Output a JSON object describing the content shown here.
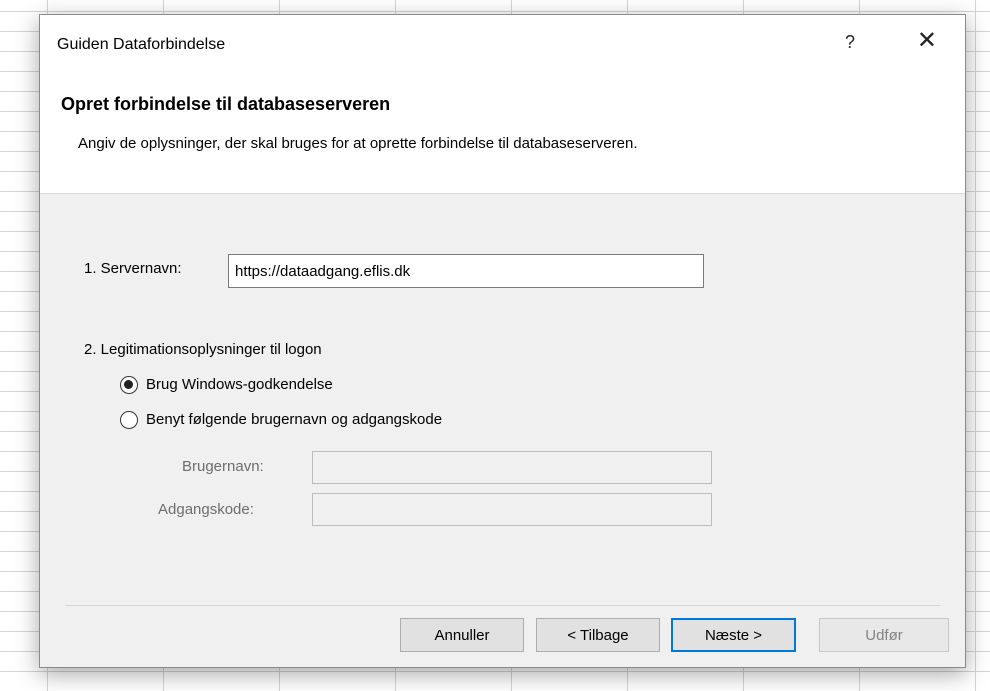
{
  "window": {
    "title": "Guiden Dataforbindelse",
    "help_label": "?",
    "close_label": "✕"
  },
  "header": {
    "title": "Opret forbindelse til databaseserveren",
    "description": "Angiv de oplysninger, der skal bruges for at oprette forbindelse til databaseserveren."
  },
  "server": {
    "label": "1. Servernavn:",
    "value": "https://dataadgang.eflis.dk"
  },
  "credentials": {
    "section_label": "2. Legitimationsoplysninger til logon",
    "options": [
      {
        "label": "Brug Windows-godkendelse",
        "selected": true
      },
      {
        "label": "Benyt følgende brugernavn og adgangskode",
        "selected": false
      }
    ],
    "username_label": "Brugernavn:",
    "username_value": "",
    "password_label": "Adgangskode:",
    "password_value": ""
  },
  "buttons": {
    "cancel": "Annuller",
    "back": "< Tilbage",
    "next": "Næste >",
    "finish": "Udfør"
  },
  "colors": {
    "default_button_border": "#0078d7",
    "dialog_background": "#f0f0f0"
  }
}
